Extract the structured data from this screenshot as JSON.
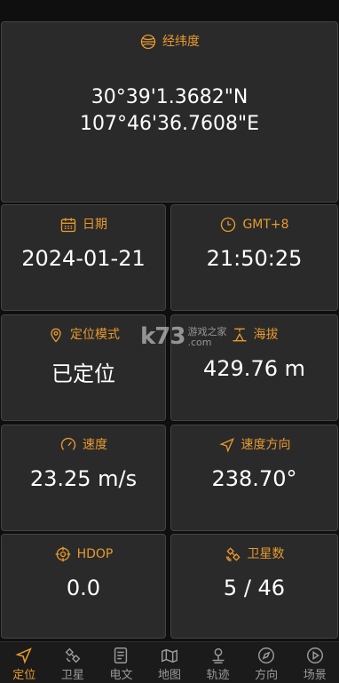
{
  "latlon": {
    "title": "经纬度",
    "lat": "30°39'1.3682\"N",
    "lon": "107°46'36.7608\"E"
  },
  "date": {
    "title": "日期",
    "value": "2024-01-21"
  },
  "time": {
    "title": "GMT+8",
    "value": "21:50:25"
  },
  "mode": {
    "title": "定位模式",
    "value": "已定位"
  },
  "altitude": {
    "title": "海拔",
    "value": "429.76 m"
  },
  "speed": {
    "title": "速度",
    "value": "23.25 m/s"
  },
  "heading": {
    "title": "速度方向",
    "value": "238.70°"
  },
  "hdop": {
    "title": "HDOP",
    "value": "0.0"
  },
  "satellites": {
    "title": "卫星数",
    "value": "5 / 46"
  },
  "tabs": [
    {
      "label": "定位",
      "icon": "navigation-arrow-icon",
      "active": true
    },
    {
      "label": "卫星",
      "icon": "satellite-icon"
    },
    {
      "label": "电文",
      "icon": "document-icon"
    },
    {
      "label": "地图",
      "icon": "map-icon"
    },
    {
      "label": "轨迹",
      "icon": "track-pin-icon"
    },
    {
      "label": "方向",
      "icon": "compass-icon"
    },
    {
      "label": "场景",
      "icon": "play-circle-icon"
    }
  ],
  "watermark": {
    "big": "k73",
    "site_cn": "游戏之家",
    "site_en": ".com"
  },
  "colors": {
    "accent": "#e89a2e",
    "card_bg": "#2a2a2a",
    "page_bg": "#0f0f0f",
    "inactive": "#9a9a9a"
  }
}
